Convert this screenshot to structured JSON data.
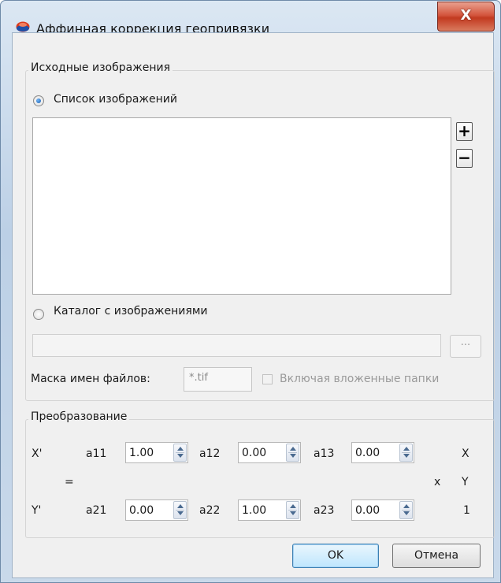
{
  "window": {
    "title": "Аффинная коррекция геопривязки",
    "close_label": "X"
  },
  "source": {
    "group_title": "Исходные изображения",
    "list_radio_label": "Список изображений",
    "add_label": "+",
    "remove_label": "−",
    "folder_radio_label": "Каталог с изображениями",
    "browse_label": "...",
    "mask_label": "Маска имен файлов:",
    "mask_value": "*.tif",
    "subfolders_label": "Включая вложенные папки"
  },
  "transform": {
    "group_title": "Преобразование",
    "x_prime": "X'",
    "y_prime": "Y'",
    "equals": "=",
    "times": "x",
    "vector": [
      "X",
      "Y",
      "1"
    ],
    "row1": [
      {
        "label": "a11",
        "value": "1.00"
      },
      {
        "label": "a12",
        "value": "0.00"
      },
      {
        "label": "a13",
        "value": "0.00"
      }
    ],
    "row2": [
      {
        "label": "a21",
        "value": "0.00"
      },
      {
        "label": "a22",
        "value": "1.00"
      },
      {
        "label": "a23",
        "value": "0.00"
      }
    ]
  },
  "buttons": {
    "ok": "OK",
    "cancel": "Отмена"
  }
}
